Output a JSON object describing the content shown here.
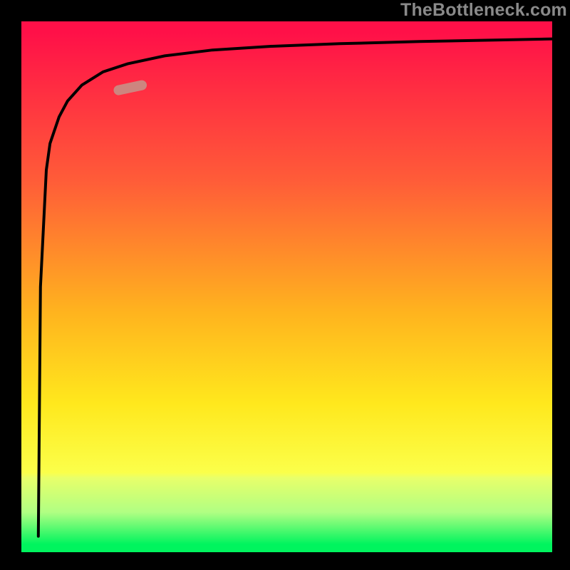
{
  "watermark": "TheBottleneck.com",
  "colors": {
    "frame": "#000000",
    "curve": "#000000",
    "marker_fill": "#c98d84",
    "gradient_top": "#ff1048",
    "gradient_bottom": "#00f45e"
  },
  "chart_data": {
    "type": "line",
    "title": "",
    "xlabel": "",
    "ylabel": "",
    "xlim": [
      0,
      100
    ],
    "ylim": [
      0,
      100
    ],
    "series": [
      {
        "name": "bottleneck-curve",
        "x": [
          3.2,
          3.6,
          4.7,
          5.4,
          7.1,
          8.7,
          11.4,
          15.4,
          20.0,
          27.0,
          36.0,
          47.0,
          60.0,
          75.0,
          90.0,
          100.0
        ],
        "y": [
          3.0,
          50.0,
          72.0,
          77.0,
          82.0,
          85.0,
          88.0,
          90.5,
          92.0,
          93.5,
          94.6,
          95.3,
          95.8,
          96.2,
          96.5,
          96.7
        ]
      }
    ],
    "marker": {
      "x_range": [
        18,
        23
      ],
      "y_value": 87.5
    },
    "background_gradient": {
      "direction": "vertical",
      "stops": [
        {
          "pos": 0.0,
          "color": "#ff1048"
        },
        {
          "pos": 0.3,
          "color": "#ff5c38"
        },
        {
          "pos": 0.55,
          "color": "#ffb41e"
        },
        {
          "pos": 0.72,
          "color": "#ffe81d"
        },
        {
          "pos": 0.86,
          "color": "#e8ff6a"
        },
        {
          "pos": 0.98,
          "color": "#00f45e"
        }
      ]
    }
  }
}
